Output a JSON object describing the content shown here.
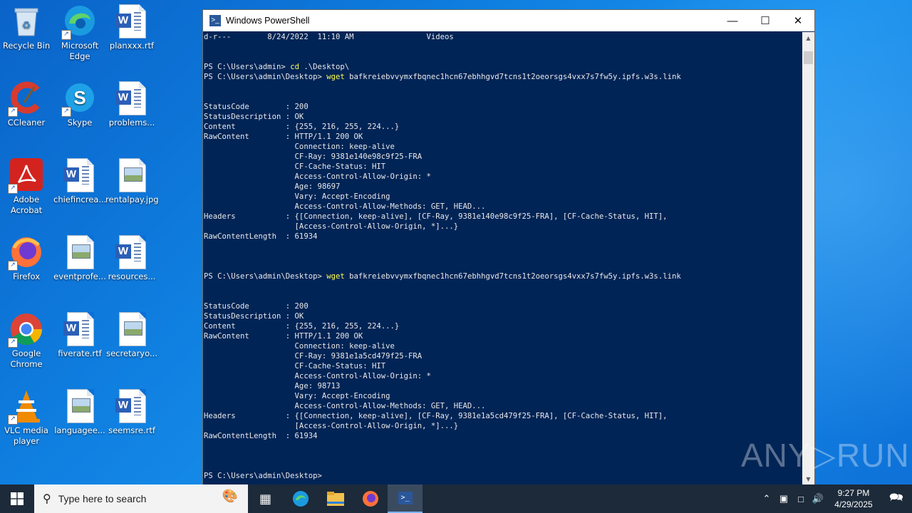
{
  "desktop": {
    "icons": [
      {
        "label": "Recycle Bin",
        "kind": "recycle"
      },
      {
        "label": "Microsoft Edge",
        "kind": "edge"
      },
      {
        "label": "planxxx.rtf",
        "kind": "word"
      },
      {
        "label": "CCleaner",
        "kind": "ccleaner"
      },
      {
        "label": "Skype",
        "kind": "skype"
      },
      {
        "label": "problems...",
        "kind": "word"
      },
      {
        "label": "Adobe Acrobat",
        "kind": "acrobat"
      },
      {
        "label": "chiefincrea...",
        "kind": "word"
      },
      {
        "label": "rentalpay.jpg",
        "kind": "image"
      },
      {
        "label": "Firefox",
        "kind": "firefox"
      },
      {
        "label": "eventprofe...",
        "kind": "image"
      },
      {
        "label": "resources...",
        "kind": "word"
      },
      {
        "label": "Google Chrome",
        "kind": "chrome"
      },
      {
        "label": "fiverate.rtf",
        "kind": "word"
      },
      {
        "label": "secretaryo...",
        "kind": "image"
      },
      {
        "label": "VLC media player",
        "kind": "vlc"
      },
      {
        "label": "languagee...",
        "kind": "image"
      },
      {
        "label": "seemsre.rtf",
        "kind": "word"
      }
    ]
  },
  "window": {
    "title": "Windows PowerShell",
    "minimize_icon": "minimize-icon",
    "maximize_icon": "maximize-icon",
    "close_icon": "close-icon"
  },
  "console": {
    "lines": [
      "d-r---        8/24/2022  11:10 AM                Videos",
      "",
      "",
      "PS C:\\Users\\admin> cd .\\Desktop\\",
      "PS C:\\Users\\admin\\Desktop> wget bafkreiebvvymxfbqnec1hcn67ebhhgvd7tcns1t2oeorsgs4vxx7s7fw5y.ipfs.w3s.link",
      "",
      "",
      "StatusCode        : 200",
      "StatusDescription : OK",
      "Content           : {255, 216, 255, 224...}",
      "RawContent        : HTTP/1.1 200 OK",
      "                    Connection: keep-alive",
      "                    CF-Ray: 9381e140e98c9f25-FRA",
      "                    CF-Cache-Status: HIT",
      "                    Access-Control-Allow-Origin: *",
      "                    Age: 98697",
      "                    Vary: Accept-Encoding",
      "                    Access-Control-Allow-Methods: GET, HEAD...",
      "Headers           : {[Connection, keep-alive], [CF-Ray, 9381e140e98c9f25-FRA], [CF-Cache-Status, HIT],",
      "                    [Access-Control-Allow-Origin, *]...}",
      "RawContentLength  : 61934",
      "",
      "",
      "",
      "PS C:\\Users\\admin\\Desktop> wget bafkreiebvvymxfbqnec1hcn67ebhhgvd7tcns1t2oeorsgs4vxx7s7fw5y.ipfs.w3s.link",
      "",
      "",
      "StatusCode        : 200",
      "StatusDescription : OK",
      "Content           : {255, 216, 255, 224...}",
      "RawContent        : HTTP/1.1 200 OK",
      "                    Connection: keep-alive",
      "                    CF-Ray: 9381e1a5cd479f25-FRA",
      "                    CF-Cache-Status: HIT",
      "                    Access-Control-Allow-Origin: *",
      "                    Age: 98713",
      "                    Vary: Accept-Encoding",
      "                    Access-Control-Allow-Methods: GET, HEAD...",
      "Headers           : {[Connection, keep-alive], [CF-Ray, 9381e1a5cd479f25-FRA], [CF-Cache-Status, HIT],",
      "                    [Access-Control-Allow-Origin, *]...}",
      "RawContentLength  : 61934",
      "",
      "",
      "",
      "PS C:\\Users\\admin\\Desktop> "
    ],
    "highlight_prefix": "PS C:\\Users\\admin\\Desktop> ",
    "highlight_word": "wget",
    "highlight_cd": "cd"
  },
  "watermark": "ANY▷RUN",
  "taskbar": {
    "search_placeholder": "Type here to search",
    "apps": [
      "task-view-icon",
      "edge-icon",
      "file-explorer-icon",
      "firefox-icon",
      "powershell-icon"
    ],
    "clock_time": "9:27 PM",
    "clock_date": "4/29/2025"
  }
}
